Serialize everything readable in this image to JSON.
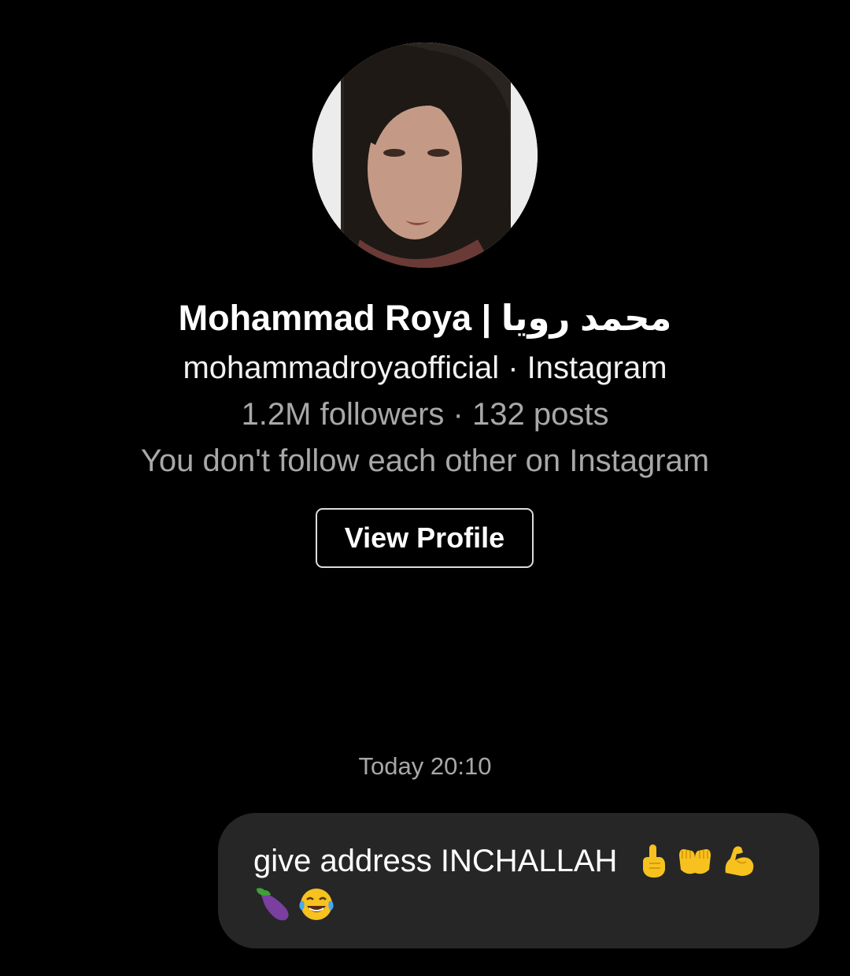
{
  "profile": {
    "name": "Mohammad Roya | محمد رويا",
    "handle_line": "mohammadroyaofficial · Instagram",
    "stats_line": "1.2M followers · 132 posts",
    "follow_status": "You don't follow each other on Instagram",
    "view_profile_label": "View Profile"
  },
  "conversation": {
    "timestamp": "Today 20:10",
    "messages": [
      {
        "direction": "outgoing",
        "text": "give address INCHALLAH",
        "emojis": [
          "index-pointing-up-icon",
          "palms-up-together-icon",
          "flexed-biceps-icon",
          "eggplant-icon",
          "face-with-tears-of-joy-icon"
        ]
      }
    ]
  },
  "colors": {
    "background": "#000000",
    "bubble": "#262626",
    "secondary_text": "#a8a8a8",
    "button_border": "#dcdcdc"
  }
}
